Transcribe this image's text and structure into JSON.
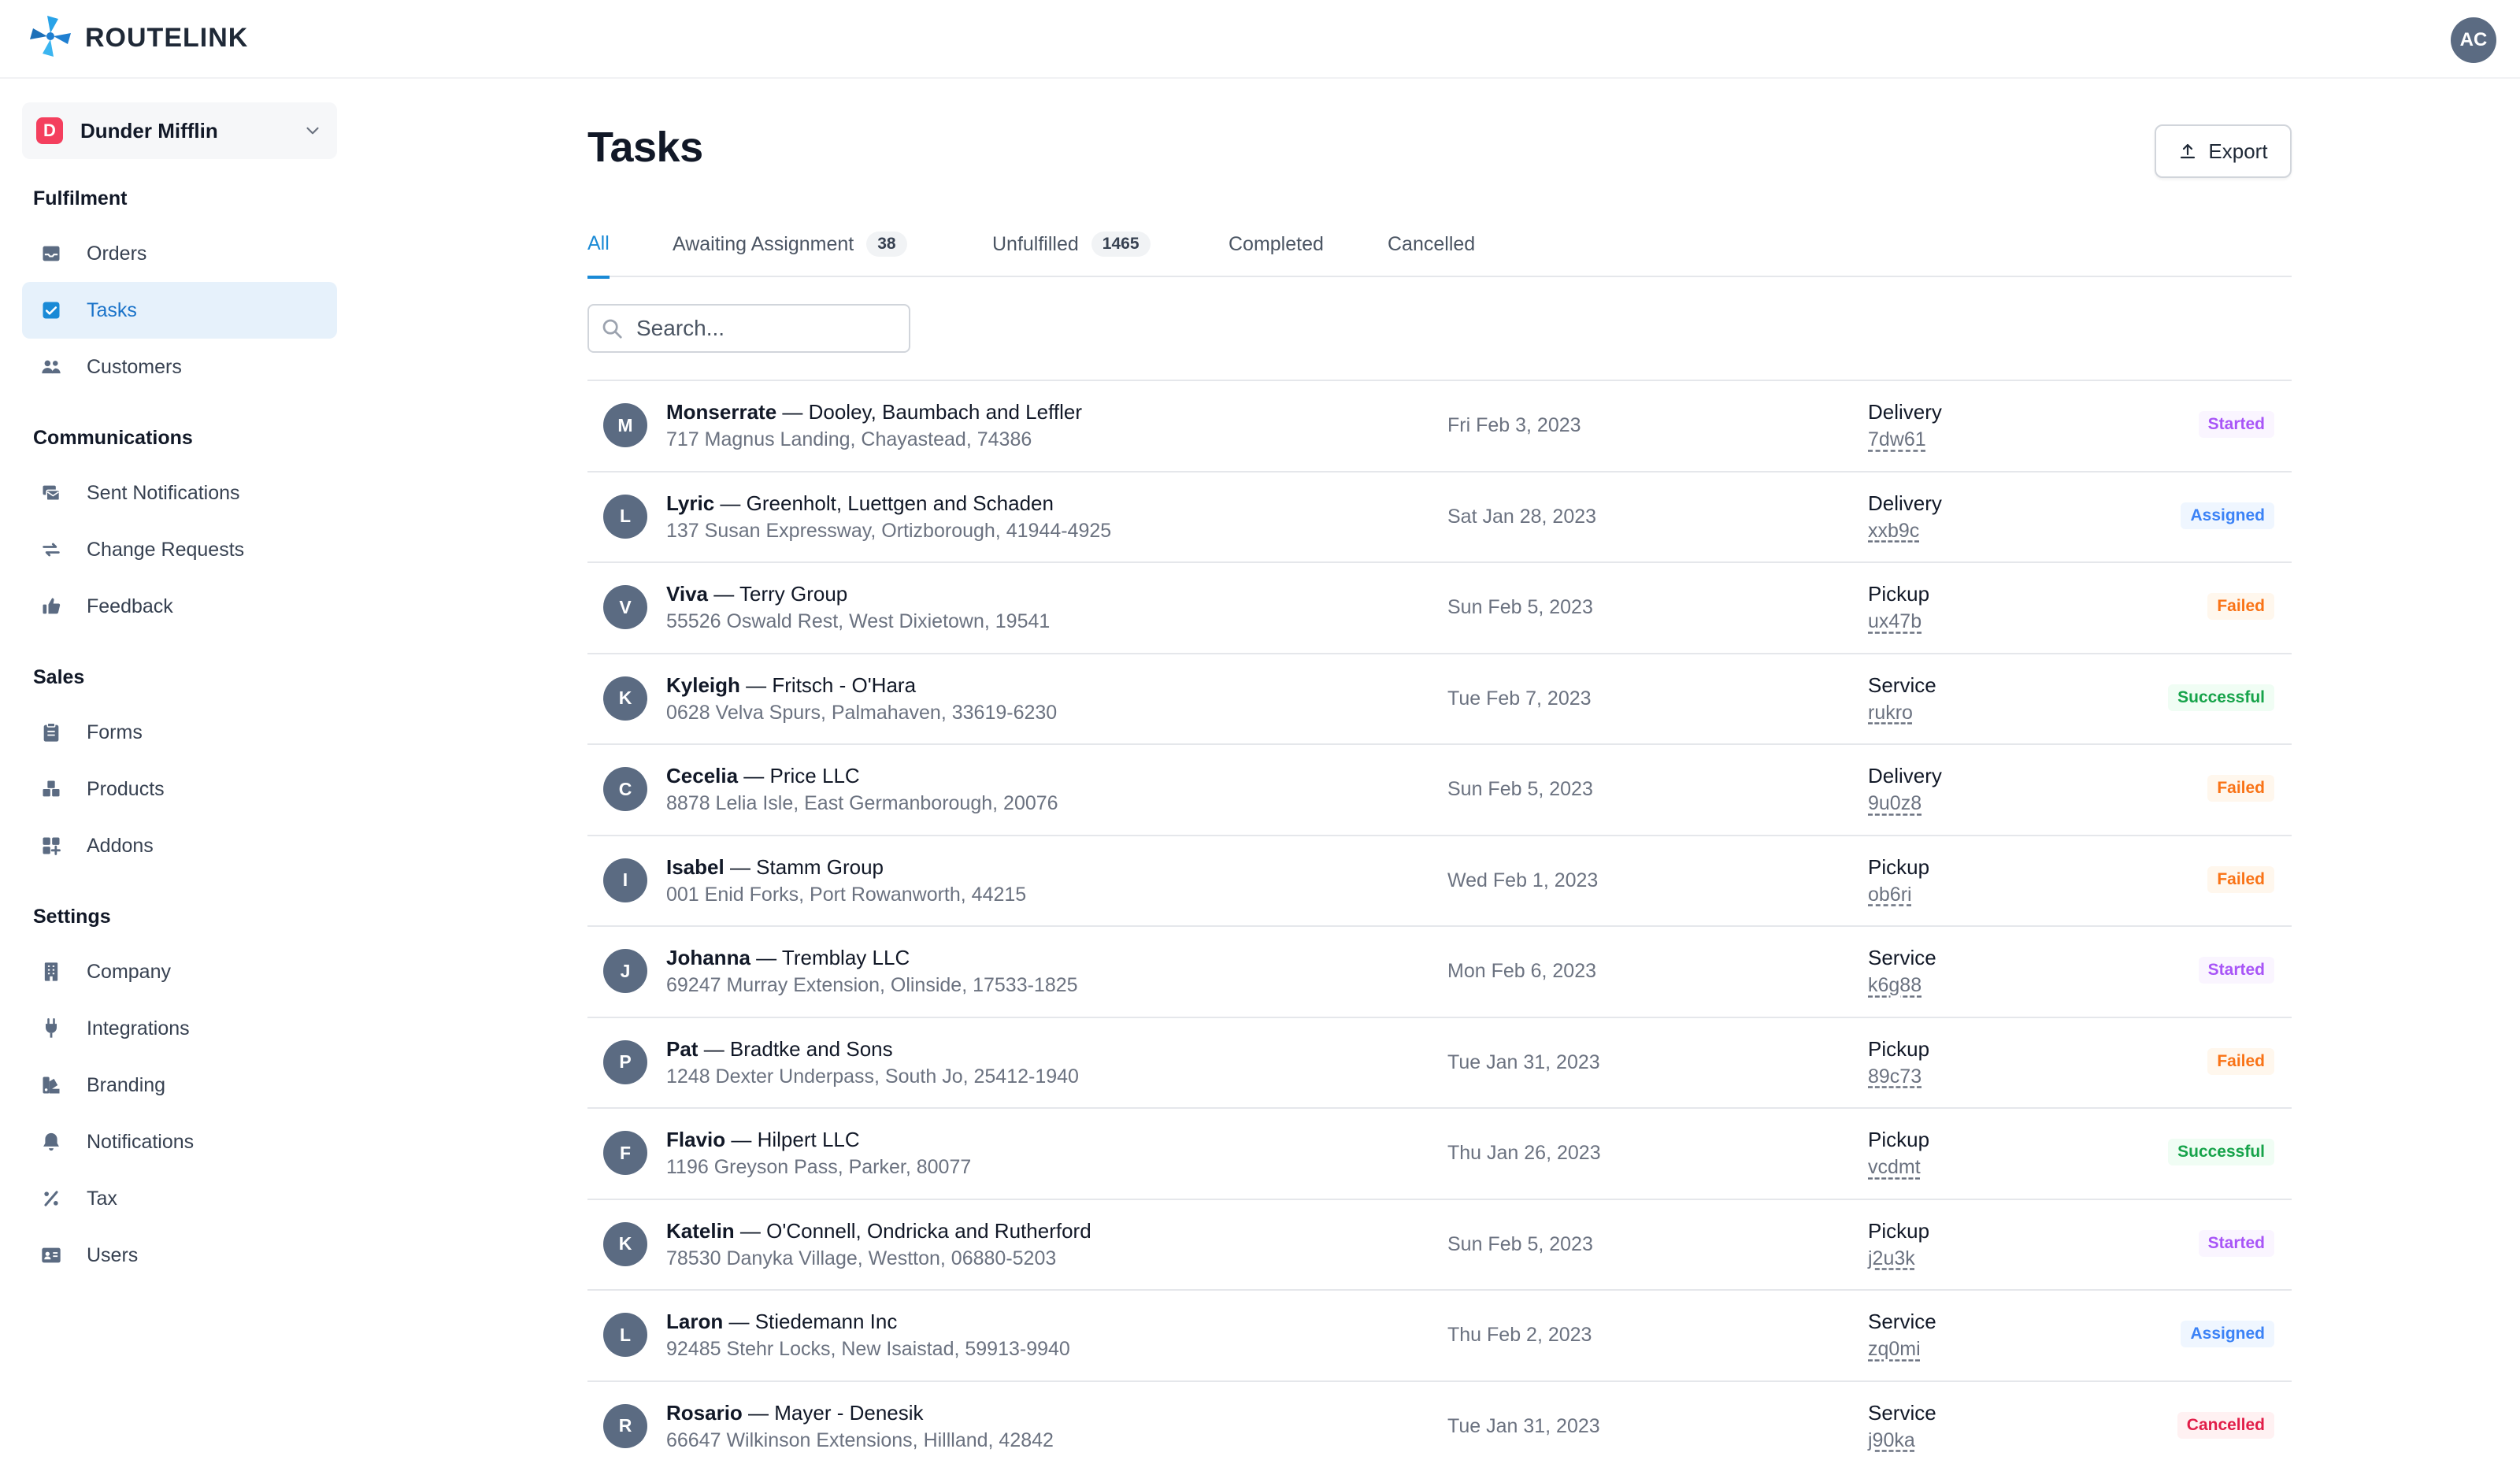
{
  "app": {
    "name": "ROUTELINK"
  },
  "user": {
    "initials": "AC"
  },
  "org": {
    "initial": "D",
    "name": "Dunder Mifflin"
  },
  "sidebar": {
    "sections": [
      {
        "title": "Fulfilment",
        "items": [
          {
            "label": "Orders",
            "icon": "inbox-icon"
          },
          {
            "label": "Tasks",
            "icon": "checkbox-icon",
            "active": true
          },
          {
            "label": "Customers",
            "icon": "users-icon"
          }
        ]
      },
      {
        "title": "Communications",
        "items": [
          {
            "label": "Sent Notifications",
            "icon": "mail-stack-icon"
          },
          {
            "label": "Change Requests",
            "icon": "arrows-exchange-icon"
          },
          {
            "label": "Feedback",
            "icon": "thumbs-up-icon"
          }
        ]
      },
      {
        "title": "Sales",
        "items": [
          {
            "label": "Forms",
            "icon": "clipboard-icon"
          },
          {
            "label": "Products",
            "icon": "boxes-icon"
          },
          {
            "label": "Addons",
            "icon": "grid-plus-icon"
          }
        ]
      },
      {
        "title": "Settings",
        "items": [
          {
            "label": "Company",
            "icon": "building-icon"
          },
          {
            "label": "Integrations",
            "icon": "plug-icon"
          },
          {
            "label": "Branding",
            "icon": "palette-icon"
          },
          {
            "label": "Notifications",
            "icon": "bell-icon"
          },
          {
            "label": "Tax",
            "icon": "percent-icon"
          },
          {
            "label": "Users",
            "icon": "id-card-icon"
          }
        ]
      }
    ]
  },
  "page": {
    "title": "Tasks",
    "export_label": "Export"
  },
  "tabs": [
    {
      "label": "All",
      "active": true
    },
    {
      "label": "Awaiting Assignment",
      "count": "38"
    },
    {
      "label": "Unfulfilled",
      "count": "1465"
    },
    {
      "label": "Completed"
    },
    {
      "label": "Cancelled"
    }
  ],
  "search": {
    "placeholder": "Search..."
  },
  "colors": {
    "accent": "#1a8ad6",
    "status": {
      "Started": {
        "fg": "#a855f7",
        "bg": "#faf5ff"
      },
      "Assigned": {
        "fg": "#3b82f6",
        "bg": "#eff6ff"
      },
      "Failed": {
        "fg": "#f97316",
        "bg": "#fff7ed"
      },
      "Successful": {
        "fg": "#16a34a",
        "bg": "#f0fdf4"
      },
      "Cancelled": {
        "fg": "#e11d48",
        "bg": "#fff1f2"
      }
    }
  },
  "tasks": [
    {
      "initial": "M",
      "name": "Monserrate",
      "company": "Dooley, Baumbach and Leffler",
      "address": "717 Magnus Landing, Chayastead, 74386",
      "date": "Fri Feb 3, 2023",
      "type": "Delivery",
      "ref": "7dw61",
      "status": "Started"
    },
    {
      "initial": "L",
      "name": "Lyric",
      "company": "Greenholt, Luettgen and Schaden",
      "address": "137 Susan Expressway, Ortizborough, 41944-4925",
      "date": "Sat Jan 28, 2023",
      "type": "Delivery",
      "ref": "xxb9c",
      "status": "Assigned"
    },
    {
      "initial": "V",
      "name": "Viva",
      "company": "Terry Group",
      "address": "55526 Oswald Rest, West Dixietown, 19541",
      "date": "Sun Feb 5, 2023",
      "type": "Pickup",
      "ref": "ux47b",
      "status": "Failed"
    },
    {
      "initial": "K",
      "name": "Kyleigh",
      "company": "Fritsch - O'Hara",
      "address": "0628 Velva Spurs, Palmahaven, 33619-6230",
      "date": "Tue Feb 7, 2023",
      "type": "Service",
      "ref": "rukro",
      "status": "Successful"
    },
    {
      "initial": "C",
      "name": "Cecelia",
      "company": "Price LLC",
      "address": "8878 Lelia Isle, East Germanborough, 20076",
      "date": "Sun Feb 5, 2023",
      "type": "Delivery",
      "ref": "9u0z8",
      "status": "Failed"
    },
    {
      "initial": "I",
      "name": "Isabel",
      "company": "Stamm Group",
      "address": "001 Enid Forks, Port Rowanworth, 44215",
      "date": "Wed Feb 1, 2023",
      "type": "Pickup",
      "ref": "ob6ri",
      "status": "Failed"
    },
    {
      "initial": "J",
      "name": "Johanna",
      "company": "Tremblay LLC",
      "address": "69247 Murray Extension, Olinside, 17533-1825",
      "date": "Mon Feb 6, 2023",
      "type": "Service",
      "ref": "k6g88",
      "status": "Started"
    },
    {
      "initial": "P",
      "name": "Pat",
      "company": "Bradtke and Sons",
      "address": "1248 Dexter Underpass, South Jo, 25412-1940",
      "date": "Tue Jan 31, 2023",
      "type": "Pickup",
      "ref": "89c73",
      "status": "Failed"
    },
    {
      "initial": "F",
      "name": "Flavio",
      "company": "Hilpert LLC",
      "address": "1196 Greyson Pass, Parker, 80077",
      "date": "Thu Jan 26, 2023",
      "type": "Pickup",
      "ref": "vcdmt",
      "status": "Successful"
    },
    {
      "initial": "K",
      "name": "Katelin",
      "company": "O'Connell, Ondricka and Rutherford",
      "address": "78530 Danyka Village, Westton, 06880-5203",
      "date": "Sun Feb 5, 2023",
      "type": "Pickup",
      "ref": "j2u3k",
      "status": "Started"
    },
    {
      "initial": "L",
      "name": "Laron",
      "company": "Stiedemann Inc",
      "address": "92485 Stehr Locks, New Isaistad, 59913-9940",
      "date": "Thu Feb 2, 2023",
      "type": "Service",
      "ref": "zq0mi",
      "status": "Assigned"
    },
    {
      "initial": "R",
      "name": "Rosario",
      "company": "Mayer - Denesik",
      "address": "66647 Wilkinson Extensions, Hillland, 42842",
      "date": "Tue Jan 31, 2023",
      "type": "Service",
      "ref": "j90ka",
      "status": "Cancelled"
    }
  ]
}
